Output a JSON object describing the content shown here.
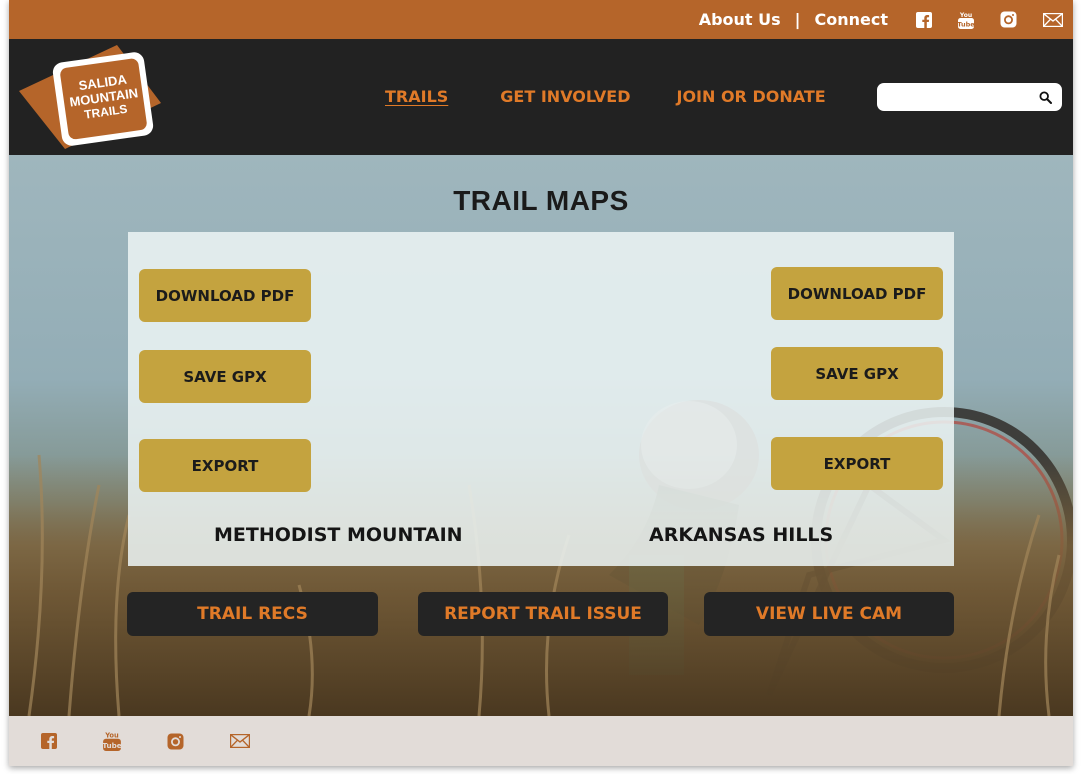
{
  "topbar": {
    "about": "About Us",
    "separator": "|",
    "connect": "Connect",
    "icons": [
      "facebook-icon",
      "youtube-icon",
      "instagram-icon",
      "mail-icon"
    ]
  },
  "header": {
    "logo": {
      "line1": "SALIDA",
      "line2": "MOUNTAIN",
      "line3": "TRAILS"
    },
    "nav": [
      "TRAILS",
      "GET INVOLVED",
      "JOIN OR DONATE"
    ],
    "search_placeholder": ""
  },
  "main": {
    "title": "TRAIL MAPS",
    "maps": [
      {
        "name": "METHODIST MOUNTAIN",
        "buttons": [
          "DOWNLOAD PDF",
          "SAVE GPX",
          "EXPORT"
        ]
      },
      {
        "name": "ARKANSAS HILLS",
        "buttons": [
          "DOWNLOAD PDF",
          "SAVE GPX",
          "EXPORT"
        ]
      }
    ],
    "actions": [
      "TRAIL RECS",
      "REPORT TRAIL ISSUE",
      "VIEW LIVE CAM"
    ]
  },
  "footer": {
    "icons": [
      "facebook-icon",
      "youtube-icon",
      "instagram-icon",
      "mail-icon"
    ]
  },
  "colors": {
    "topbar": "#b5652a",
    "header": "#222222",
    "accent_orange": "#e07a28",
    "gold_button": "#c4a33f",
    "dark_button": "#242424",
    "footer": "#e2dcd8"
  }
}
